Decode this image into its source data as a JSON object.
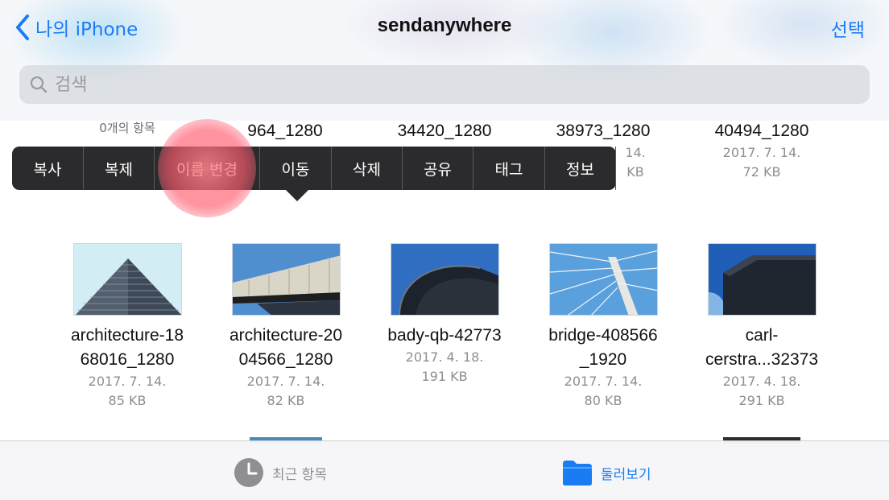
{
  "nav": {
    "back_label": "나의 iPhone",
    "title": "sendanywhere",
    "select_label": "선택"
  },
  "search": {
    "placeholder": "검색"
  },
  "top_row": {
    "count_label": "0개의 항목",
    "items": [
      {
        "name": "964_1280"
      },
      {
        "name": "34420_1280"
      },
      {
        "name": "38973_1280",
        "date": "14.",
        "size": "KB"
      },
      {
        "name": "40494_1280",
        "date": "2017. 7. 14.",
        "size": "72 KB"
      }
    ]
  },
  "context_menu": {
    "items": [
      "복사",
      "복제",
      "이름 변경",
      "이동",
      "삭제",
      "공유",
      "태그",
      "정보"
    ]
  },
  "files": [
    {
      "name_line1": "architecture-18",
      "name_line2": "68016_1280",
      "date": "2017. 7. 14.",
      "size": "85 KB"
    },
    {
      "name_line1": "architecture-20",
      "name_line2": "04566_1280",
      "date": "2017. 7. 14.",
      "size": "82 KB"
    },
    {
      "name_line1": "bady-qb-42773",
      "name_line2": "",
      "date": "2017. 4. 18.",
      "size": "191 KB"
    },
    {
      "name_line1": "bridge-408566",
      "name_line2": "_1920",
      "date": "2017. 7. 14.",
      "size": "80 KB"
    },
    {
      "name_line1": "carl-",
      "name_line2": "cerstra...32373",
      "date": "2017. 4. 18.",
      "size": "291 KB"
    }
  ],
  "tab_bar": {
    "recent_label": "최근 항목",
    "browse_label": "둘러보기"
  },
  "colors": {
    "accent": "#1a7cf5",
    "menu_bg": "#2b2b2d",
    "secondary_text": "#8e8e93",
    "inactive_tab": "#8e8e93"
  },
  "icons": {
    "back": "chevron-left-icon",
    "search": "magnifier-icon",
    "recent": "clock-icon",
    "browse": "folder-icon"
  }
}
